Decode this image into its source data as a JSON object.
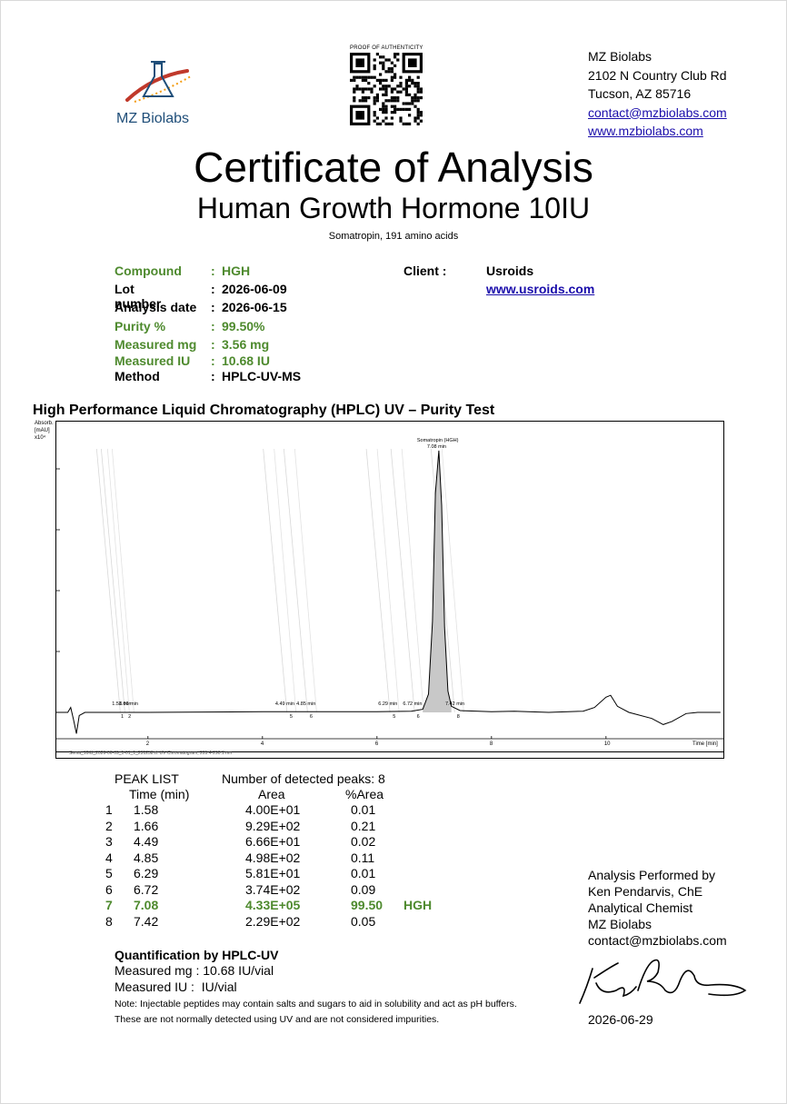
{
  "header": {
    "logo_name": "MZ Biolabs",
    "qr_caption": "PROOF OF AUTHENTICITY",
    "address": {
      "company": "MZ Biolabs",
      "street": "2102 N Country Club Rd",
      "city": "Tucson, AZ 85716",
      "email": "contact@mzbiolabs.com",
      "website": "www.mzbiolabs.com"
    }
  },
  "title": "Certificate of Analysis",
  "subtitle": "Human Growth Hormone  10IU",
  "description": "Somatropin, 191 amino acids",
  "info": {
    "compound": {
      "label": "Compound",
      "sep": ":",
      "value": "HGH"
    },
    "lot": {
      "label": "Lot number",
      "sep": ":",
      "value": "2026-06-09"
    },
    "date": {
      "label": "Analysis date",
      "sep": ":",
      "value": "2026-06-15"
    },
    "purity": {
      "label": "Purity %",
      "sep": ":",
      "value": "99.50%"
    },
    "mg": {
      "label": "Measured mg",
      "sep": ":",
      "value": "3.56 mg"
    },
    "iu": {
      "label": "Measured IU",
      "sep": ":",
      "value": "10.68 IU"
    },
    "method": {
      "label": "Method",
      "sep": ":",
      "value": "HPLC-UV-MS"
    },
    "client_label": "Client :",
    "client_name": "Usroids",
    "client_url": "www.usroids.com"
  },
  "hplc": {
    "section_title": "High Performance Liquid Chromatography (HPLC) UV – Purity Test",
    "legend_text": "Sema_10IU_2026-06-09_1-01_1_231238.d: UV Chromatogram, 205.4-290.1 nm"
  },
  "chart_data": {
    "type": "line",
    "ylabel_lines": [
      "Absorb.",
      "[mAU]",
      "x10⁴"
    ],
    "xlabel": "Time [min]",
    "x_ticks": [
      "2",
      "4",
      "6",
      "8",
      "10"
    ],
    "y_ticks": [
      "0",
      "1",
      "2",
      "3",
      "4"
    ],
    "xlim": [
      0,
      12
    ],
    "ylim": [
      -0.4,
      4.8
    ],
    "main_peak_label": [
      "Somatropin (HGH)",
      "7.08 min"
    ],
    "peak_labels": [
      "1.58 min",
      "1.66 min",
      "4.49 min",
      "4.85 min",
      "6.29 min",
      "6.72 min",
      "7.42 min"
    ],
    "peak_numbers": [
      "1",
      "2",
      "5",
      "6",
      "5",
      "6",
      "8"
    ],
    "baseline_trace": [
      [
        0.0,
        0.0
      ],
      [
        0.6,
        0.0
      ],
      [
        0.65,
        0.08
      ],
      [
        0.7,
        -0.12
      ],
      [
        0.75,
        -0.35
      ],
      [
        0.8,
        -0.05
      ],
      [
        0.9,
        0.0
      ],
      [
        2.0,
        0.0
      ],
      [
        4.0,
        0.01
      ],
      [
        6.0,
        0.01
      ],
      [
        6.6,
        0.02
      ],
      [
        6.8,
        0.05
      ],
      [
        6.9,
        0.3
      ],
      [
        6.97,
        1.5
      ],
      [
        7.02,
        3.6
      ],
      [
        7.08,
        4.3
      ],
      [
        7.13,
        3.4
      ],
      [
        7.18,
        1.4
      ],
      [
        7.24,
        0.35
      ],
      [
        7.3,
        0.1
      ],
      [
        7.45,
        0.03
      ],
      [
        8.0,
        0.01
      ],
      [
        8.4,
        0.02
      ],
      [
        9.0,
        0.0
      ],
      [
        9.6,
        0.02
      ],
      [
        9.8,
        0.08
      ],
      [
        10.0,
        0.25
      ],
      [
        10.08,
        0.28
      ],
      [
        10.2,
        0.1
      ],
      [
        10.4,
        0.0
      ],
      [
        10.8,
        -0.1
      ],
      [
        11.0,
        -0.2
      ],
      [
        11.15,
        -0.15
      ],
      [
        11.4,
        -0.02
      ],
      [
        11.6,
        0.0
      ],
      [
        12.0,
        0.0
      ]
    ]
  },
  "peak_list": {
    "title": "PEAK LIST",
    "count_text": "Number of detected peaks: 8",
    "headers": [
      "Time (min)",
      "Area",
      "%Area"
    ],
    "rows": [
      {
        "n": "1",
        "time": "1.58",
        "area": "4.00E+01",
        "pct": "0.01",
        "tag": ""
      },
      {
        "n": "2",
        "time": "1.66",
        "area": "9.29E+02",
        "pct": "0.21",
        "tag": ""
      },
      {
        "n": "3",
        "time": "4.49",
        "area": "6.66E+01",
        "pct": "0.02",
        "tag": ""
      },
      {
        "n": "4",
        "time": "4.85",
        "area": "4.98E+02",
        "pct": "0.11",
        "tag": ""
      },
      {
        "n": "5",
        "time": "6.29",
        "area": "5.81E+01",
        "pct": "0.01",
        "tag": ""
      },
      {
        "n": "6",
        "time": "6.72",
        "area": "3.74E+02",
        "pct": "0.09",
        "tag": ""
      },
      {
        "n": "7",
        "time": "7.08",
        "area": "4.33E+05",
        "pct": "99.50",
        "tag": "HGH"
      },
      {
        "n": "8",
        "time": "7.42",
        "area": "2.29E+02",
        "pct": "0.05",
        "tag": ""
      }
    ]
  },
  "quantification": {
    "title": "Quantification by HPLC-UV",
    "mg_line": "Measured mg : 10.68 IU/vial",
    "iu_line": "Measured IU :  IU/vial",
    "note1": "Note: Injectable peptides may contain salts and sugars to aid in solubility and act as pH buffers.",
    "note2": "These are not normally detected using UV and are not considered impurities."
  },
  "signature": {
    "line1": "Analysis Performed by",
    "line2": "Ken Pendarvis, ChE",
    "line3": "Analytical Chemist",
    "line4": "MZ Biolabs",
    "line5": "contact@mzbiolabs.com",
    "date": "2026-06-29"
  },
  "colors": {
    "green": "#4e8a2e",
    "link": "#1a0dab",
    "logo_blue": "#1f4e79",
    "logo_red": "#c0392b",
    "logo_orange": "#f39c12"
  }
}
